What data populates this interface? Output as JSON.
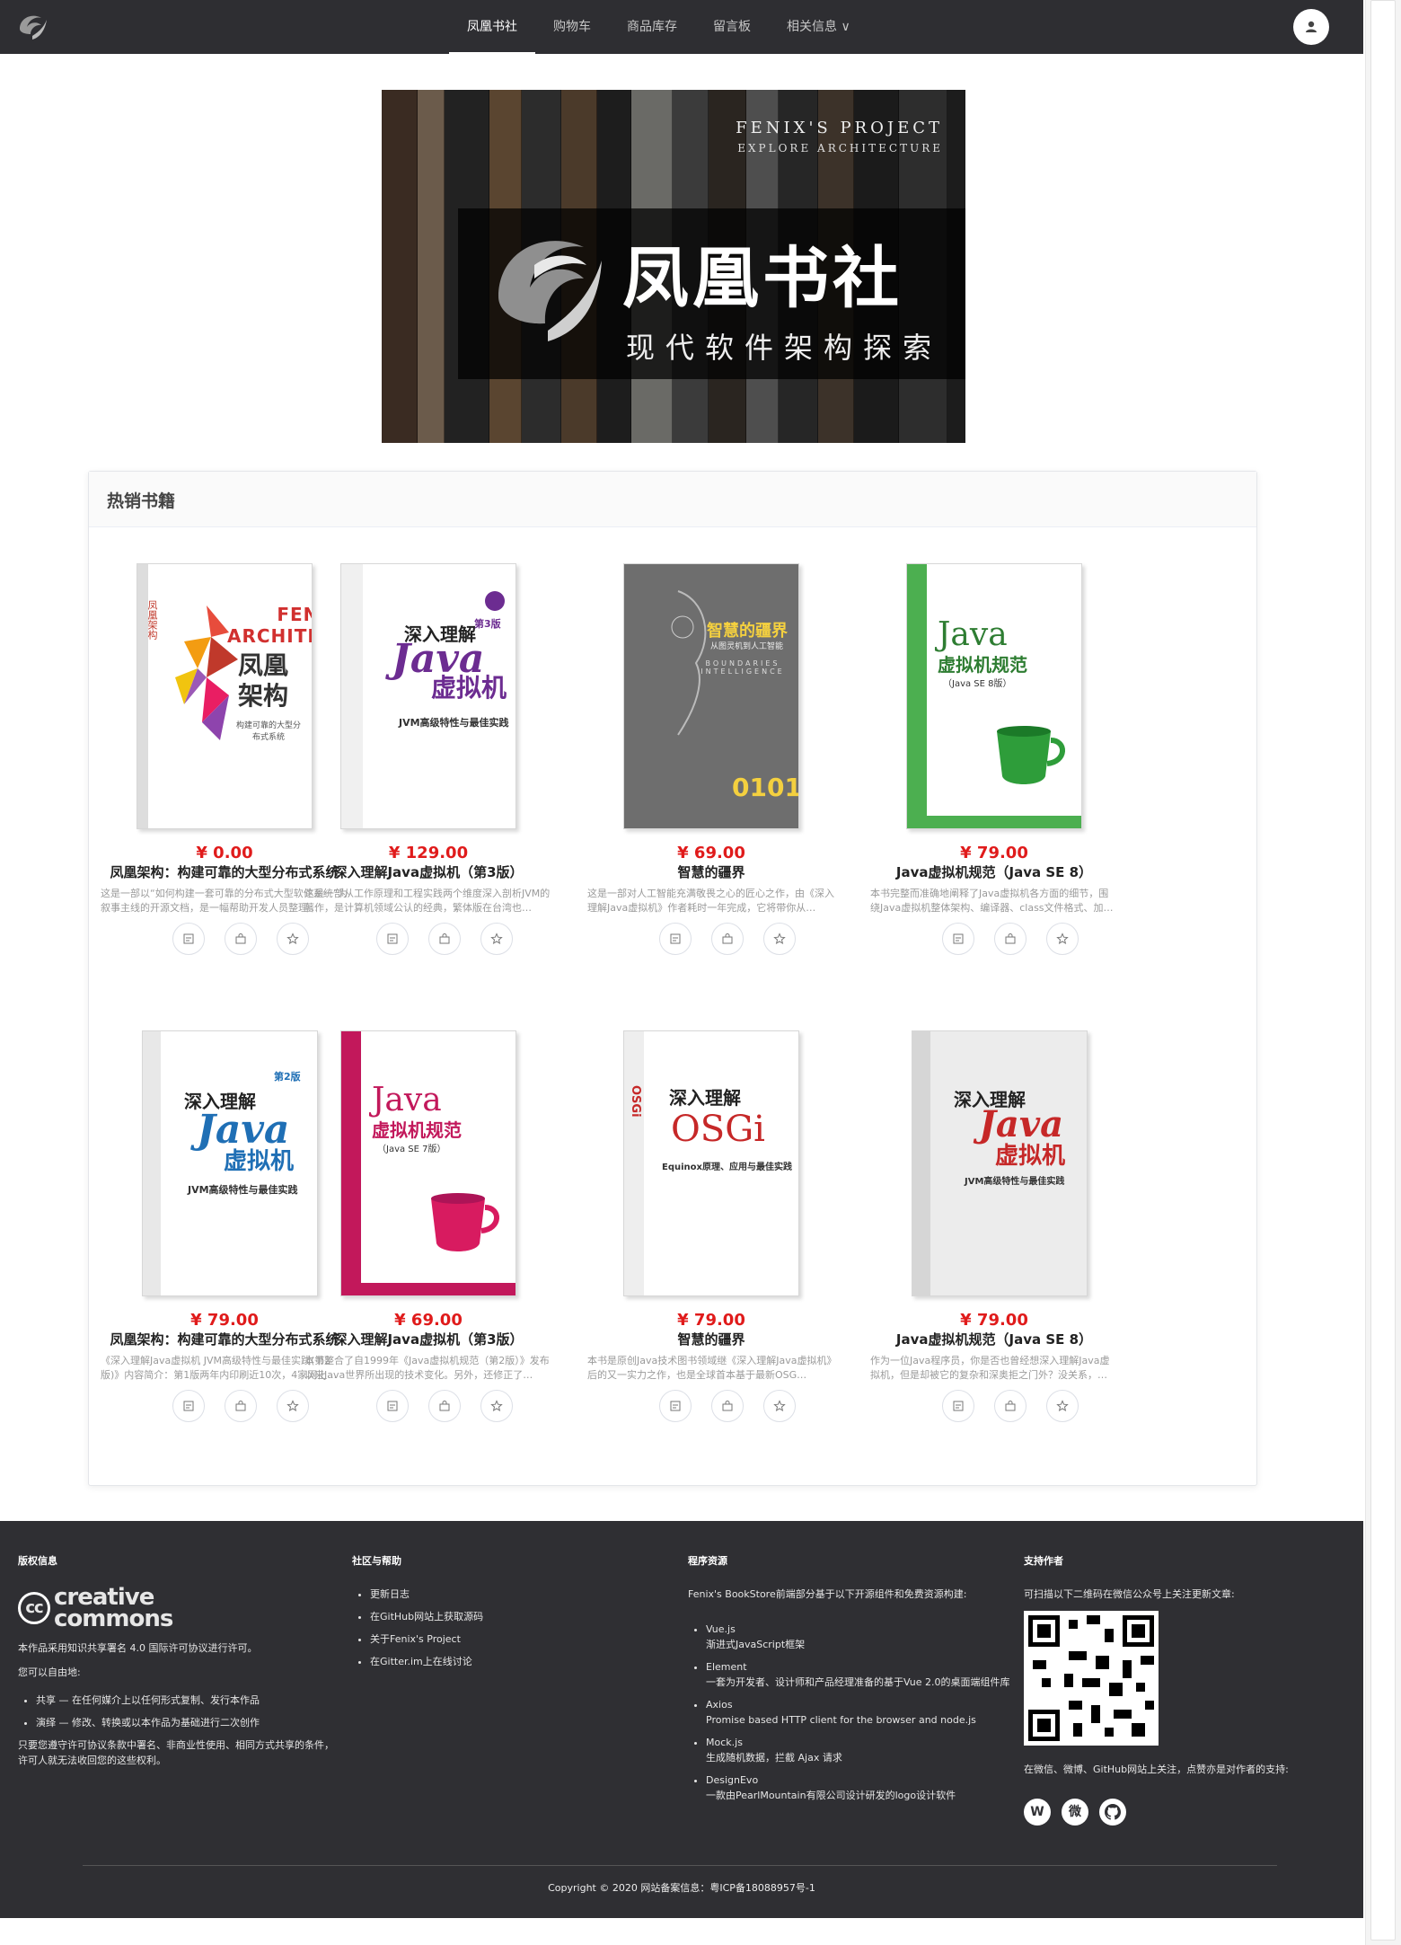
{
  "nav": {
    "items": [
      "凤凰书社",
      "购物车",
      "商品库存",
      "留言板",
      "相关信息 ∨"
    ],
    "active_index": 0
  },
  "banner": {
    "en_line1": "FENIX'S PROJECT",
    "en_line2": "EXPLORE ARCHITECTURE",
    "title": "凤凰书社",
    "subtitle": "现代软件架构探索"
  },
  "section": {
    "title": "热销书籍"
  },
  "books": [
    {
      "price": "¥ 0.00",
      "title": "凤凰架构：构建可靠的大型分布式系统",
      "desc": "这是一部以“如何构建一套可靠的分布式大型软件系统”为叙事主线的开源文档，是一幅帮助开发人员整理…",
      "cover": {
        "style": "fenix",
        "title": "凤凰架构",
        "sub": "构建可靠的大型分布式系统",
        "brand": "FENIX ARCHITECTURE"
      }
    },
    {
      "price": "¥ 129.00",
      "title": "深入理解Java虚拟机（第3版）",
      "desc": "这是一部从工作原理和工程实践两个维度深入剖析JVM的著作，是计算机领域公认的经典，繁体版在台湾也…",
      "cover": {
        "style": "jvm3",
        "title": "深入理解",
        "java": "Java",
        "vm": "虚拟机",
        "sub": "JVM高级特性与最佳实践",
        "edition": "第3版"
      }
    },
    {
      "price": "¥ 69.00",
      "title": "智慧的疆界",
      "desc": "这是一部对人工智能充满敬畏之心的匠心之作，由《深入理解Java虚拟机》作者耗时一年完成，它将带你从…",
      "cover": {
        "style": "ai",
        "title": "智慧的疆界",
        "sub": "从图灵机到人工智能",
        "en": "BOUNDARIES INTELLIGENCE"
      }
    },
    {
      "price": "¥ 79.00",
      "title": "Java虚拟机规范（Java SE 8）",
      "desc": "本书完整而准确地阐释了Java虚拟机各方面的细节，围绕Java虚拟机整体架构、编译器、class文件格式、加…",
      "cover": {
        "style": "spec8",
        "java": "Java",
        "title": "虚拟机规范",
        "sub": "（Java SE 8版）"
      }
    },
    {
      "price": "¥ 79.00",
      "title": "凤凰架构：构建可靠的大型分布式系统",
      "desc": "《深入理解Java虚拟机 JVM高级特性与最佳实践(第2版)》内容简介：第1版两年内印刷近10次，4家网上…",
      "cover": {
        "style": "jvm2",
        "title": "深入理解",
        "java": "Java",
        "vm": "虚拟机",
        "sub": "JVM高级特性与最佳实践",
        "edition": "第2版"
      }
    },
    {
      "price": "¥ 69.00",
      "title": "深入理解Java虚拟机（第3版）",
      "desc": "本书整合了自1999年《Java虚拟机规范（第2版）》发布以来Java世界所出现的技术变化。另外，还修正了…",
      "cover": {
        "style": "spec7",
        "java": "Java",
        "title": "虚拟机规范",
        "sub": "（Java SE 7版）"
      }
    },
    {
      "price": "¥ 79.00",
      "title": "智慧的疆界",
      "desc": "本书是原创Java技术图书领域继《深入理解Java虚拟机》后的又一实力之作，也是全球首本基于最新OSG…",
      "cover": {
        "style": "osgi",
        "title": "深入理解",
        "java": "OSGi",
        "sub": "Equinox原理、应用与最佳实践"
      }
    },
    {
      "price": "¥ 79.00",
      "title": "Java虚拟机规范（Java SE 8）",
      "desc": "作为一位Java程序员，你是否也曾经想深入理解Java虚拟机，但是却被它的复杂和深奥拒之门外？没关系，…",
      "cover": {
        "style": "jvm1",
        "title": "深入理解",
        "java": "Java",
        "vm": "虚拟机",
        "sub": "JVM高级特性与最佳实践"
      }
    }
  ],
  "footer": {
    "license": {
      "heading": "版权信息",
      "cc_text": "creative commons",
      "intro": "本作品采用知识共享署名 4.0 国际许可协议进行许可。",
      "free_label": "您可以自由地:",
      "items": [
        "共享 — 在任何媒介上以任何形式复制、发行本作品",
        "演绎 — 修改、转换或以本作品为基础进行二次创作"
      ],
      "terms": "只要您遵守许可协议条款中署名、非商业性使用、相同方式共享的条件，许可人就无法收回您的这些权利。"
    },
    "community": {
      "heading": "社区与帮助",
      "items": [
        "更新日志",
        "在GitHub网站上获取源码",
        "关于Fenix's Project",
        "在Gitter.im上在线讨论"
      ]
    },
    "resources": {
      "heading": "程序资源",
      "intro": "Fenix's BookStore前端部分基于以下开源组件和免费资源构建:",
      "items": [
        {
          "name": "Vue.js",
          "desc": "渐进式JavaScript框架"
        },
        {
          "name": "Element",
          "desc": "一套为开发者、设计师和产品经理准备的基于Vue 2.0的桌面端组件库"
        },
        {
          "name": "Axios",
          "desc": "Promise based HTTP client for the browser and node.js"
        },
        {
          "name": "Mock.js",
          "desc": "生成随机数据，拦截 Ajax 请求"
        },
        {
          "name": "DesignEvo",
          "desc": "一款由PearlMountain有限公司设计研发的logo设计软件"
        }
      ]
    },
    "support": {
      "heading": "支持作者",
      "qr_text": "可扫描以下二维码在微信公众号上关注更新文章:",
      "follow_text": "在微信、微博、GitHub网站上关注，点赞亦是对作者的支持:"
    },
    "copyright": "Copyright © 2020 网站备案信息：粤ICP备18088957号-1"
  },
  "colors": {
    "nav_bg": "#2e2e32",
    "price": "#e01b1b",
    "footer_bg": "#2f2f33"
  }
}
